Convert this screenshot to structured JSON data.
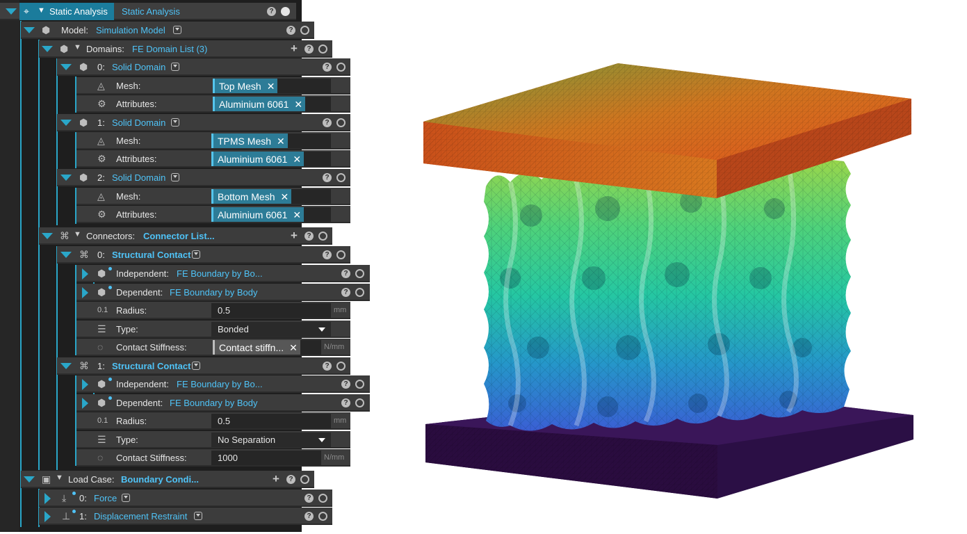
{
  "analysis": {
    "title": "Static Analysis",
    "name": "Static Analysis"
  },
  "model": {
    "label": "Model:",
    "value": "Simulation Model"
  },
  "domains": {
    "label": "Domains:",
    "value": "FE Domain List (3)",
    "items": [
      {
        "index": "0:",
        "type": "Solid Domain",
        "mesh_label": "Mesh:",
        "mesh": "Top Mesh",
        "attr_label": "Attributes:",
        "attr": "Aluminium 6061"
      },
      {
        "index": "1:",
        "type": "Solid Domain",
        "mesh_label": "Mesh:",
        "mesh": "TPMS Mesh",
        "attr_label": "Attributes:",
        "attr": "Aluminium 6061"
      },
      {
        "index": "2:",
        "type": "Solid Domain",
        "mesh_label": "Mesh:",
        "mesh": "Bottom Mesh",
        "attr_label": "Attributes:",
        "attr": "Aluminium 6061"
      }
    ]
  },
  "connectors": {
    "label": "Connectors:",
    "value": "Connector List...",
    "items": [
      {
        "index": "0:",
        "type": "Structural Contact",
        "independent_label": "Independent:",
        "independent": "FE Boundary by Bo...",
        "dependent_label": "Dependent:",
        "dependent": "FE Boundary by Body",
        "radius_label": "Radius:",
        "radius": "0.5",
        "radius_unit": "mm",
        "type_label": "Type:",
        "contact_type": "Bonded",
        "stiffness_label": "Contact Stiffness:",
        "stiffness": "Contact stiffn...",
        "stiffness_unit": "N/mm"
      },
      {
        "index": "1:",
        "type": "Structural Contact",
        "independent_label": "Independent:",
        "independent": "FE Boundary by Bo...",
        "dependent_label": "Dependent:",
        "dependent": "FE Boundary by Body",
        "radius_label": "Radius:",
        "radius": "0.5",
        "radius_unit": "mm",
        "type_label": "Type:",
        "contact_type": "No Separation",
        "stiffness_label": "Contact Stiffness:",
        "stiffness": "1000",
        "stiffness_unit": "N/mm"
      }
    ]
  },
  "loadcase": {
    "label": "Load Case:",
    "value": "Boundary Condi...",
    "items": [
      {
        "index": "0:",
        "name": "Force"
      },
      {
        "index": "1:",
        "name": "Displacement Restraint"
      }
    ]
  },
  "common": {
    "help": "?",
    "remove": "✕",
    "add": "+"
  },
  "colors": {
    "accent": "#2aa7c9",
    "link": "#4fc3f7",
    "chip": "#2d7c97",
    "panel": "#3c3c3c"
  }
}
